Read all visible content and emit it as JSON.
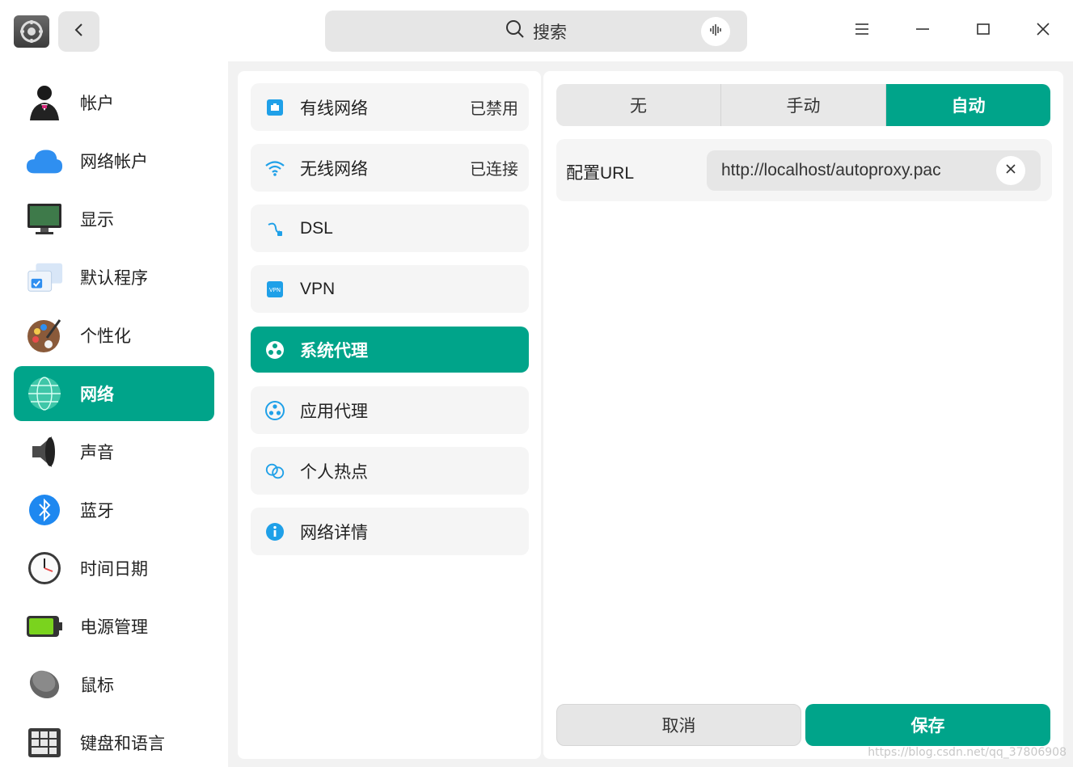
{
  "window": {
    "search": {
      "placeholder": "搜索"
    }
  },
  "sidebar": {
    "items": [
      {
        "label": "帐户",
        "icon": "account-icon"
      },
      {
        "label": "网络帐户",
        "icon": "cloud-icon"
      },
      {
        "label": "显示",
        "icon": "display-icon"
      },
      {
        "label": "默认程序",
        "icon": "default-apps-icon"
      },
      {
        "label": "个性化",
        "icon": "palette-icon"
      },
      {
        "label": "网络",
        "icon": "network-icon",
        "active": true
      },
      {
        "label": "声音",
        "icon": "speaker-icon"
      },
      {
        "label": "蓝牙",
        "icon": "bluetooth-icon"
      },
      {
        "label": "时间日期",
        "icon": "clock-icon"
      },
      {
        "label": "电源管理",
        "icon": "battery-icon"
      },
      {
        "label": "鼠标",
        "icon": "mouse-icon"
      },
      {
        "label": "键盘和语言",
        "icon": "keyboard-icon"
      }
    ]
  },
  "network": {
    "items": [
      {
        "label": "有线网络",
        "status": "已禁用",
        "icon": "wired-icon"
      },
      {
        "label": "无线网络",
        "status": "已连接",
        "icon": "wifi-icon"
      },
      {
        "label": "DSL",
        "status": "",
        "icon": "dsl-icon"
      },
      {
        "label": "VPN",
        "status": "",
        "icon": "vpn-icon"
      },
      {
        "label": "系统代理",
        "status": "",
        "icon": "system-proxy-icon",
        "active": true
      },
      {
        "label": "应用代理",
        "status": "",
        "icon": "app-proxy-icon"
      },
      {
        "label": "个人热点",
        "status": "",
        "icon": "hotspot-icon"
      },
      {
        "label": "网络详情",
        "status": "",
        "icon": "info-icon"
      }
    ]
  },
  "proxy": {
    "modes": [
      "无",
      "手动",
      "自动"
    ],
    "selected_mode": "自动",
    "config_url_label": "配置URL",
    "config_url_value": "http://localhost/autoproxy.pac",
    "cancel_label": "取消",
    "save_label": "保存"
  },
  "colors": {
    "accent": "#00a48a"
  },
  "watermark": "https://blog.csdn.net/qq_37806908"
}
